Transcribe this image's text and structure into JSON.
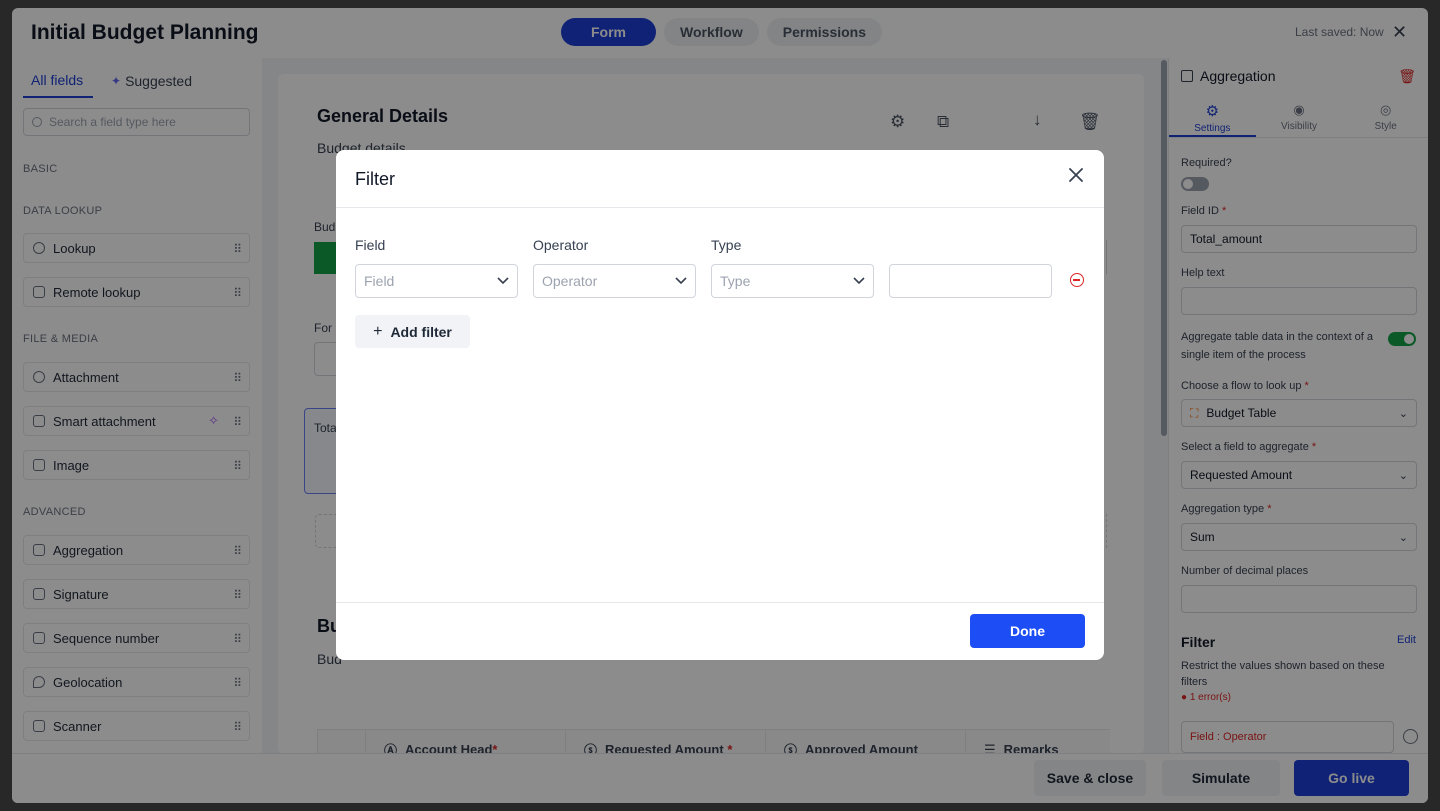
{
  "app": {
    "title": "Initial Budget Planning",
    "tabs": [
      {
        "label": "Form",
        "active": true
      },
      {
        "label": "Workflow",
        "active": false
      },
      {
        "label": "Permissions",
        "active": false
      }
    ],
    "last_saved": "Last saved: Now",
    "close_glyph": "✕"
  },
  "left_panel": {
    "tabs": [
      {
        "label": "All fields",
        "active": true
      },
      {
        "label": "Suggested",
        "active": false
      }
    ],
    "search_placeholder": "Search a field type here",
    "sections": {
      "basic": "BASIC",
      "data_lookup": "DATA LOOKUP",
      "file_media": "FILE & MEDIA",
      "advanced": "ADVANCED"
    },
    "items": {
      "lookup": "Lookup",
      "remote_lookup": "Remote lookup",
      "attachment": "Attachment",
      "smart_attachment": "Smart attachment",
      "image": "Image",
      "aggregation": "Aggregation",
      "signature": "Signature",
      "sequence_number": "Sequence number",
      "geolocation": "Geolocation",
      "scanner": "Scanner"
    }
  },
  "canvas": {
    "general_title": "General Details",
    "general_sub": "Budget details",
    "frag_bud": "Bud",
    "frag_for": "For",
    "frag_tota": "Tota",
    "frag_bu2": "Bu",
    "frag_bud2": "Bud",
    "columns": [
      {
        "label": "Account Head",
        "required": "*"
      },
      {
        "label": "Requested Amount",
        "required": " *"
      },
      {
        "label": "Approved Amount",
        "required": ""
      },
      {
        "label": "Remarks",
        "required": ""
      }
    ]
  },
  "right_panel": {
    "title": "Aggregation",
    "tabs": [
      {
        "label": "Settings",
        "active": true
      },
      {
        "label": "Visibility",
        "active": false
      },
      {
        "label": "Style",
        "active": false
      }
    ],
    "required_label": "Required?",
    "field_id_label": "Field ID",
    "field_id_value": "Total_amount",
    "help_text_label": "Help text",
    "aggregate_context_label": "Aggregate table data in the context of a single item of the process",
    "flow_label": "Choose a flow to look up",
    "flow_value": "Budget Table",
    "field_agg_label": "Select a field to aggregate",
    "field_agg_value": "Requested Amount",
    "agg_type_label": "Aggregation type",
    "agg_type_value": "Sum",
    "decimal_label": "Number of decimal places",
    "filter_title": "Filter",
    "filter_edit": "Edit",
    "filter_desc": "Restrict the values shown based on these filters",
    "filter_errors": "● 1 error(s)",
    "filter_chip": "Field : Operator",
    "required_star": "*"
  },
  "bottom_bar": {
    "save_close": "Save & close",
    "simulate": "Simulate",
    "go_live": "Go live"
  },
  "modal": {
    "title": "Filter",
    "col_field": "Field",
    "col_operator": "Operator",
    "col_type": "Type",
    "field_placeholder": "Field",
    "operator_placeholder": "Operator",
    "type_placeholder": "Type",
    "add_filter": "Add filter",
    "done": "Done"
  },
  "colors": {
    "primary": "#1d4ef5",
    "active_tab": "#1d3fd6",
    "danger": "#dc2626",
    "toggle_on": "#16a34a"
  }
}
